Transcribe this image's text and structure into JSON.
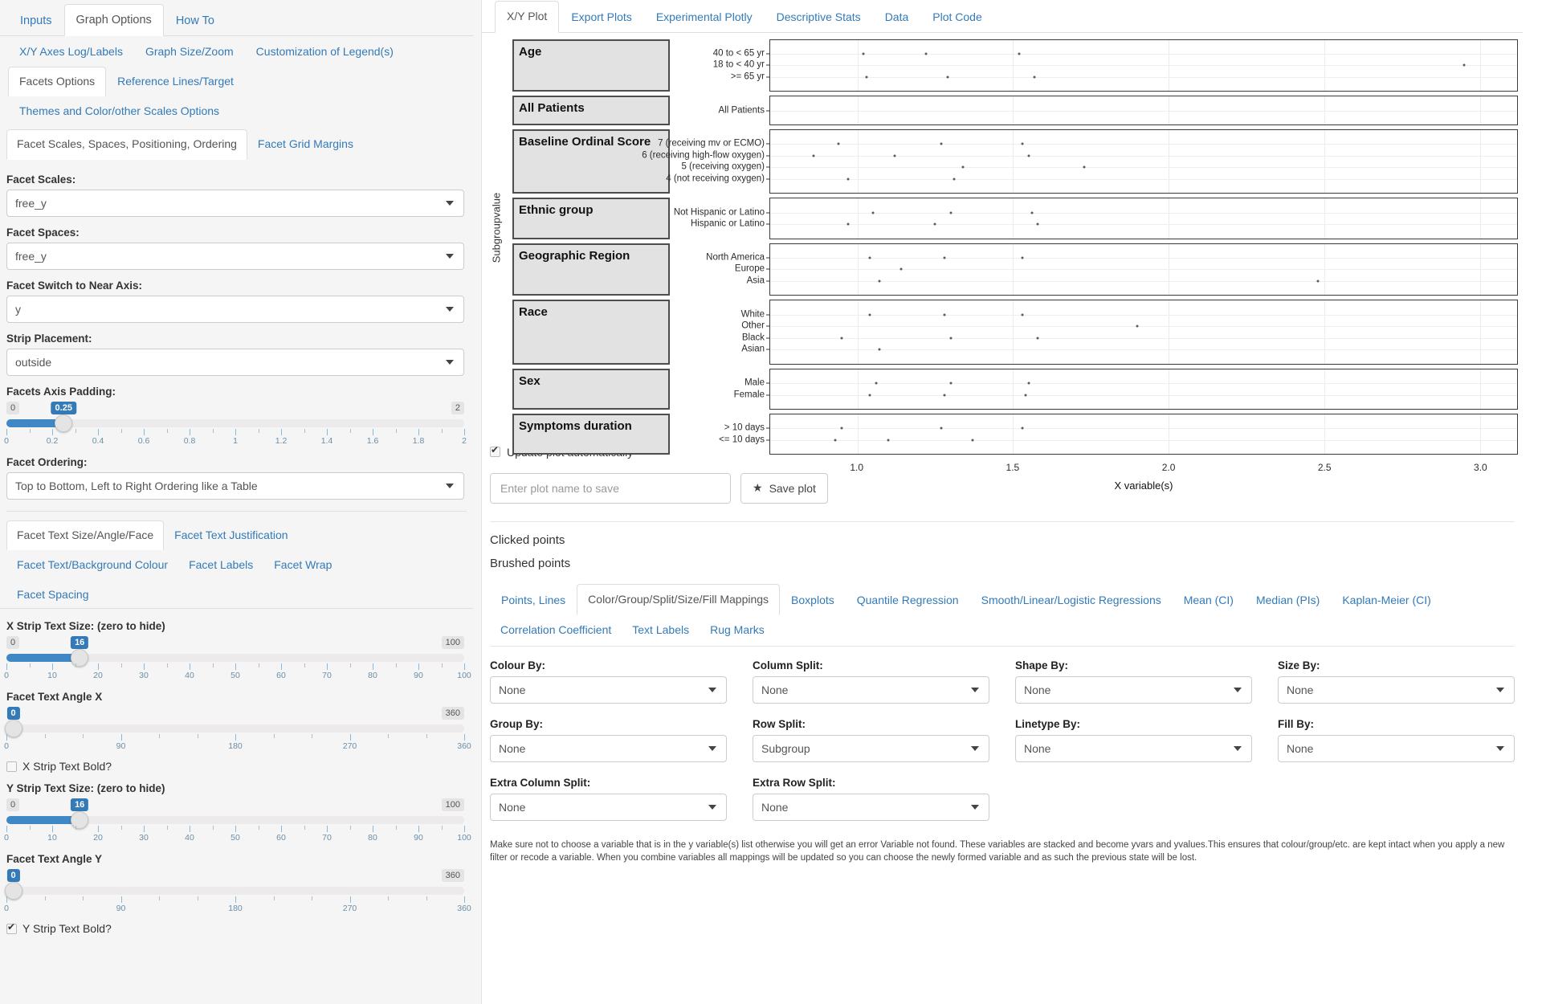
{
  "left_panel": {
    "main_tabs": [
      {
        "label": "Inputs",
        "active": false
      },
      {
        "label": "Graph Options",
        "active": true
      },
      {
        "label": "How To",
        "active": false
      }
    ],
    "graph_sub_tabs": [
      {
        "label": "X/Y Axes Log/Labels",
        "active": false
      },
      {
        "label": "Graph Size/Zoom",
        "active": false
      },
      {
        "label": "Customization of Legend(s)",
        "active": false
      }
    ],
    "graph_sub_tabs_row2": [
      {
        "label": "Facets Options",
        "active": true
      },
      {
        "label": "Reference Lines/Target",
        "active": false
      }
    ],
    "graph_sub_tabs_row3": [
      {
        "label": "Themes and Color/other Scales Options",
        "active": false
      }
    ],
    "facet_tabs": [
      {
        "label": "Facet Scales, Spaces, Positioning, Ordering",
        "active": true
      },
      {
        "label": "Facet Grid Margins",
        "active": false
      }
    ],
    "controls": {
      "facet_scales_label": "Facet Scales:",
      "facet_scales_value": "free_y",
      "facet_spaces_label": "Facet Spaces:",
      "facet_spaces_value": "free_y",
      "facet_switch_label": "Facet Switch to Near Axis:",
      "facet_switch_value": "y",
      "strip_placement_label": "Strip Placement:",
      "strip_placement_value": "outside",
      "facets_axis_padding_label": "Facets Axis Padding:",
      "facets_axis_padding_value": "0.25",
      "facets_axis_padding_min": "0",
      "facets_axis_padding_max": "2",
      "facets_axis_padding_ticks": [
        "0",
        "0.2",
        "0.4",
        "0.6",
        "0.8",
        "1",
        "1.2",
        "1.4",
        "1.6",
        "1.8",
        "2"
      ],
      "facet_ordering_label": "Facet Ordering:",
      "facet_ordering_value": "Top to Bottom, Left to Right Ordering like a Table"
    },
    "text_tabs": [
      {
        "label": "Facet Text Size/Angle/Face",
        "active": true
      },
      {
        "label": "Facet Text Justification",
        "active": false
      }
    ],
    "text_tabs_row2": [
      {
        "label": "Facet Text/Background Colour",
        "active": false
      },
      {
        "label": "Facet Labels",
        "active": false
      },
      {
        "label": "Facet Wrap",
        "active": false
      }
    ],
    "text_tabs_row3": [
      {
        "label": "Facet Spacing",
        "active": false
      }
    ],
    "text_controls": {
      "x_strip_size_label": "X Strip Text Size: (zero to hide)",
      "x_strip_size_value": "16",
      "x_strip_size_min": "0",
      "x_strip_size_max": "100",
      "size_ticks": [
        "0",
        "10",
        "20",
        "30",
        "40",
        "50",
        "60",
        "70",
        "80",
        "90",
        "100"
      ],
      "x_angle_label": "Facet Text Angle X",
      "x_angle_value": "0",
      "x_angle_min": "0",
      "x_angle_max": "360",
      "angle_ticks": [
        "0",
        "90",
        "180",
        "270",
        "360"
      ],
      "x_bold_label": "X Strip Text Bold?",
      "x_bold_checked": false,
      "y_strip_size_label": "Y Strip Text Size: (zero to hide)",
      "y_strip_size_value": "16",
      "y_strip_size_min": "0",
      "y_strip_size_max": "100",
      "y_angle_label": "Facet Text Angle Y",
      "y_angle_value": "0",
      "y_angle_min": "0",
      "y_angle_max": "360",
      "y_bold_label": "Y Strip Text Bold?",
      "y_bold_checked": true
    }
  },
  "right_panel": {
    "top_tabs": [
      {
        "label": "X/Y Plot",
        "active": true
      },
      {
        "label": "Export Plots",
        "active": false
      },
      {
        "label": "Experimental Plotly",
        "active": false
      },
      {
        "label": "Descriptive Stats",
        "active": false
      },
      {
        "label": "Data",
        "active": false
      },
      {
        "label": "Plot Code",
        "active": false
      }
    ],
    "update_auto_label": "Update plot automatically",
    "update_auto_checked": true,
    "save_placeholder": "Enter plot name to save",
    "save_button_label": "Save plot",
    "clicked_points_label": "Clicked points",
    "brushed_points_label": "Brushed points",
    "mapping_tabs": [
      {
        "label": "Points, Lines",
        "active": false
      },
      {
        "label": "Color/Group/Split/Size/Fill Mappings",
        "active": true
      },
      {
        "label": "Boxplots",
        "active": false
      },
      {
        "label": "Quantile Regression",
        "active": false
      },
      {
        "label": "Smooth/Linear/Logistic Regressions",
        "active": false
      },
      {
        "label": "Mean (CI)",
        "active": false
      },
      {
        "label": "Median (PIs)",
        "active": false
      },
      {
        "label": "Kaplan-Meier (CI)",
        "active": false
      }
    ],
    "mapping_tabs_row2": [
      {
        "label": "Correlation Coefficient",
        "active": false
      },
      {
        "label": "Text Labels",
        "active": false
      },
      {
        "label": "Rug Marks",
        "active": false
      }
    ],
    "mapping_fields": [
      {
        "label": "Colour By:",
        "value": "None"
      },
      {
        "label": "Column Split:",
        "value": "None"
      },
      {
        "label": "Shape By:",
        "value": "None"
      },
      {
        "label": "Size By:",
        "value": "None"
      },
      {
        "label": "Group By:",
        "value": "None"
      },
      {
        "label": "Row Split:",
        "value": "Subgroup"
      },
      {
        "label": "Linetype By:",
        "value": "None"
      },
      {
        "label": "Fill By:",
        "value": "None"
      },
      {
        "label": "Extra Column Split:",
        "value": "None"
      },
      {
        "label": "Extra Row Split:",
        "value": "None"
      }
    ],
    "note": "Make sure not to choose a variable that is in the y variable(s) list otherwise you will get an error Variable not found. These variables are stacked and become yvars and yvalues.This ensures that colour/group/etc. are kept intact when you apply a new filter or recode a variable. When you combine variables all mappings will be updated so you can choose the newly formed variable and as such the previous state will be lost."
  },
  "chart_data": {
    "type": "scatter",
    "title": "",
    "xlabel": "X variable(s)",
    "ylabel": "Subgroupvalue",
    "xlim": [
      0.72,
      3.12
    ],
    "xticks": [
      1.0,
      1.5,
      2.0,
      2.5,
      3.0
    ],
    "xticklabels": [
      "1.0",
      "1.5",
      "2.0",
      "2.5",
      "3.0"
    ],
    "grid": true,
    "legend": "none",
    "facet_strip_side": "left",
    "facets": [
      {
        "strip": "Age",
        "categories": [
          "40 to < 65 yr",
          "18 to < 40 yr",
          ">= 65 yr"
        ],
        "points": [
          {
            "y": "40 to < 65 yr",
            "x": 1.02
          },
          {
            "y": "40 to < 65 yr",
            "x": 1.22
          },
          {
            "y": "40 to < 65 yr",
            "x": 1.52
          },
          {
            "y": "18 to < 40 yr",
            "x": 2.95
          },
          {
            "y": ">= 65 yr",
            "x": 1.03
          },
          {
            "y": ">= 65 yr",
            "x": 1.29
          },
          {
            "y": ">= 65 yr",
            "x": 1.57
          }
        ]
      },
      {
        "strip": "All Patients",
        "categories": [
          "All Patients"
        ],
        "points": []
      },
      {
        "strip": "Baseline Ordinal Score",
        "categories": [
          "7 (receiving mv or ECMO)",
          "6 (receiving high-flow oxygen)",
          "5 (receiving oxygen)",
          "4 (not receiving oxygen)"
        ],
        "points": [
          {
            "y": "7 (receiving mv or ECMO)",
            "x": 0.94
          },
          {
            "y": "7 (receiving mv or ECMO)",
            "x": 1.27
          },
          {
            "y": "7 (receiving mv or ECMO)",
            "x": 1.53
          },
          {
            "y": "6 (receiving high-flow oxygen)",
            "x": 0.86
          },
          {
            "y": "6 (receiving high-flow oxygen)",
            "x": 1.12
          },
          {
            "y": "6 (receiving high-flow oxygen)",
            "x": 1.55
          },
          {
            "y": "5 (receiving oxygen)",
            "x": 1.34
          },
          {
            "y": "5 (receiving oxygen)",
            "x": 1.73
          },
          {
            "y": "4 (not receiving oxygen)",
            "x": 0.97
          },
          {
            "y": "4 (not receiving oxygen)",
            "x": 1.31
          }
        ]
      },
      {
        "strip": "Ethnic group",
        "categories": [
          "Not Hispanic or Latino",
          "Hispanic or Latino"
        ],
        "points": [
          {
            "y": "Not Hispanic or Latino",
            "x": 1.05
          },
          {
            "y": "Not Hispanic or Latino",
            "x": 1.3
          },
          {
            "y": "Not Hispanic or Latino",
            "x": 1.56
          },
          {
            "y": "Hispanic or Latino",
            "x": 0.97
          },
          {
            "y": "Hispanic or Latino",
            "x": 1.25
          },
          {
            "y": "Hispanic or Latino",
            "x": 1.58
          }
        ]
      },
      {
        "strip": "Geographic Region",
        "categories": [
          "North America",
          "Europe",
          "Asia"
        ],
        "points": [
          {
            "y": "North America",
            "x": 1.04
          },
          {
            "y": "North America",
            "x": 1.28
          },
          {
            "y": "North America",
            "x": 1.53
          },
          {
            "y": "Europe",
            "x": 1.14
          },
          {
            "y": "Asia",
            "x": 1.07
          },
          {
            "y": "Asia",
            "x": 2.48
          }
        ]
      },
      {
        "strip": "Race",
        "categories": [
          "White",
          "Other",
          "Black",
          "Asian"
        ],
        "points": [
          {
            "y": "White",
            "x": 1.04
          },
          {
            "y": "White",
            "x": 1.28
          },
          {
            "y": "White",
            "x": 1.53
          },
          {
            "y": "Other",
            "x": 1.9
          },
          {
            "y": "Black",
            "x": 0.95
          },
          {
            "y": "Black",
            "x": 1.3
          },
          {
            "y": "Black",
            "x": 1.58
          },
          {
            "y": "Asian",
            "x": 1.07
          }
        ]
      },
      {
        "strip": "Sex",
        "categories": [
          "Male",
          "Female"
        ],
        "points": [
          {
            "y": "Male",
            "x": 1.06
          },
          {
            "y": "Male",
            "x": 1.3
          },
          {
            "y": "Male",
            "x": 1.55
          },
          {
            "y": "Female",
            "x": 1.04
          },
          {
            "y": "Female",
            "x": 1.28
          },
          {
            "y": "Female",
            "x": 1.54
          }
        ]
      },
      {
        "strip": "Symptoms duration",
        "categories": [
          "> 10 days",
          "<= 10 days"
        ],
        "points": [
          {
            "y": "> 10 days",
            "x": 0.95
          },
          {
            "y": "> 10 days",
            "x": 1.27
          },
          {
            "y": "> 10 days",
            "x": 1.53
          },
          {
            "y": "<= 10 days",
            "x": 0.93
          },
          {
            "y": "<= 10 days",
            "x": 1.1
          },
          {
            "y": "<= 10 days",
            "x": 1.37
          }
        ]
      }
    ]
  }
}
